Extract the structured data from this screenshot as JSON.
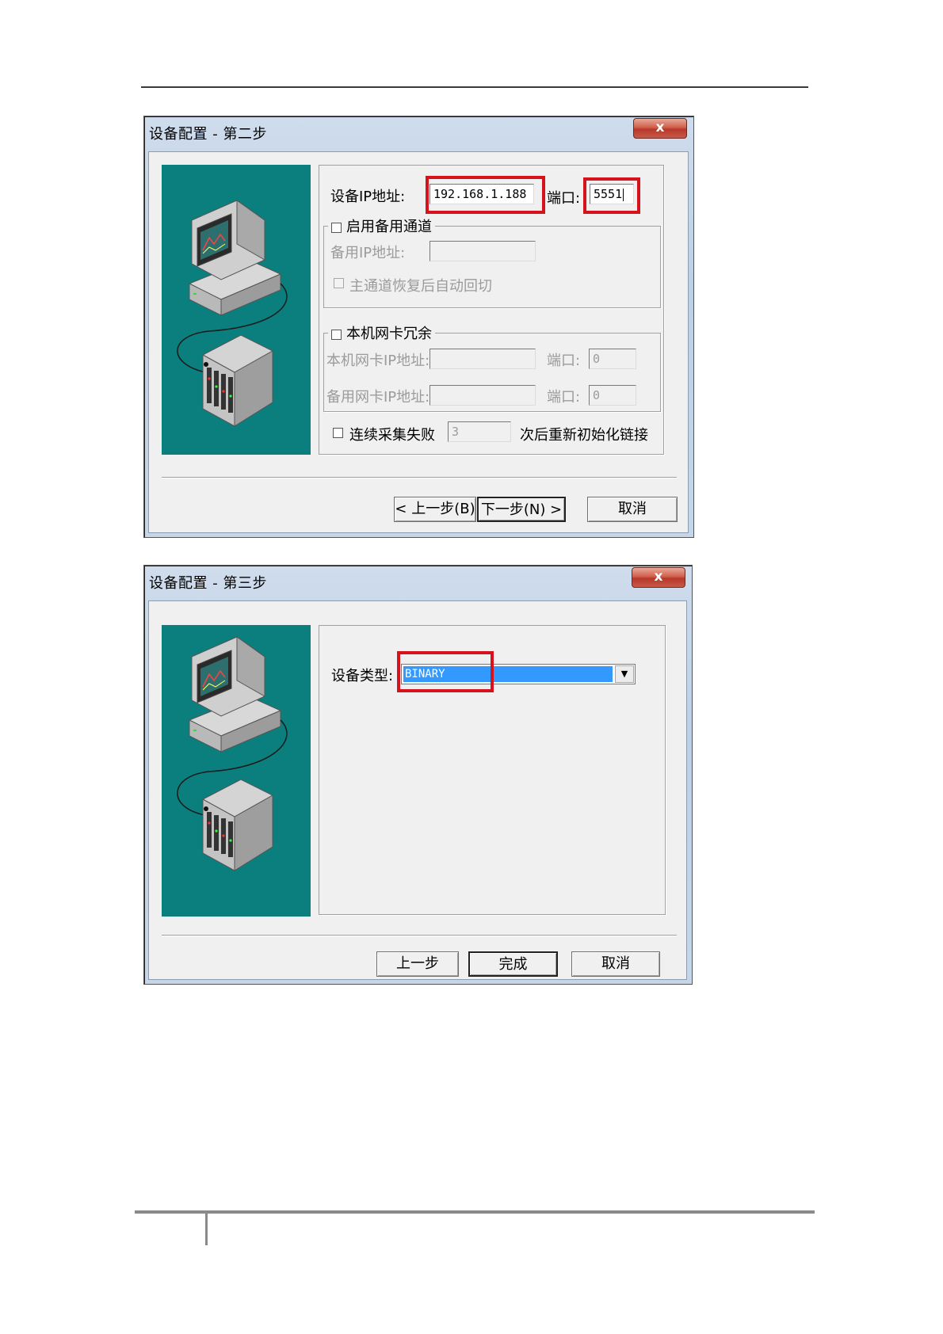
{
  "dialog1": {
    "title": "设备配置 - 第二步",
    "close_label": "x",
    "ip_label": "设备IP地址:",
    "ip_value": "192.168.1.188",
    "port_label": "端口:",
    "port_value": "5551",
    "backup_channel": {
      "checkbox_label": "启用备用通道",
      "checked": false,
      "backup_ip_label": "备用IP地址:",
      "backup_ip_value": "",
      "auto_switch_label": "主通道恢复后自动回切",
      "auto_switch_checked": false
    },
    "nic_redundancy": {
      "checkbox_label": "本机网卡冗余",
      "checked": false,
      "local_nic_ip_label": "本机网卡IP地址:",
      "local_nic_ip_value": "",
      "local_port_label": "端口:",
      "local_port_value": "0",
      "backup_nic_ip_label": "备用网卡IP地址:",
      "backup_nic_ip_value": "",
      "backup_port_label": "端口:",
      "backup_port_value": "0"
    },
    "reconnect": {
      "prefix_label": "连续采集失败",
      "count_value": "3",
      "suffix_label": "次后重新初始化链接",
      "checked": false
    },
    "buttons": {
      "prev": "< 上一步(B)",
      "next": "下一步(N) >",
      "cancel": "取消"
    }
  },
  "dialog2": {
    "title": "设备配置 - 第三步",
    "close_label": "x",
    "device_type_label": "设备类型:",
    "device_type_value": "BINARY",
    "buttons": {
      "prev": "上一步",
      "finish": "完成",
      "cancel": "取消"
    }
  },
  "colors": {
    "highlight": "#d6131d",
    "art_background": "#0b7e7e",
    "selection": "#3399ff"
  },
  "icons": [
    "computer-icon",
    "cable-icon",
    "plc-rack-icon",
    "close-icon",
    "dropdown-arrow-icon"
  ]
}
